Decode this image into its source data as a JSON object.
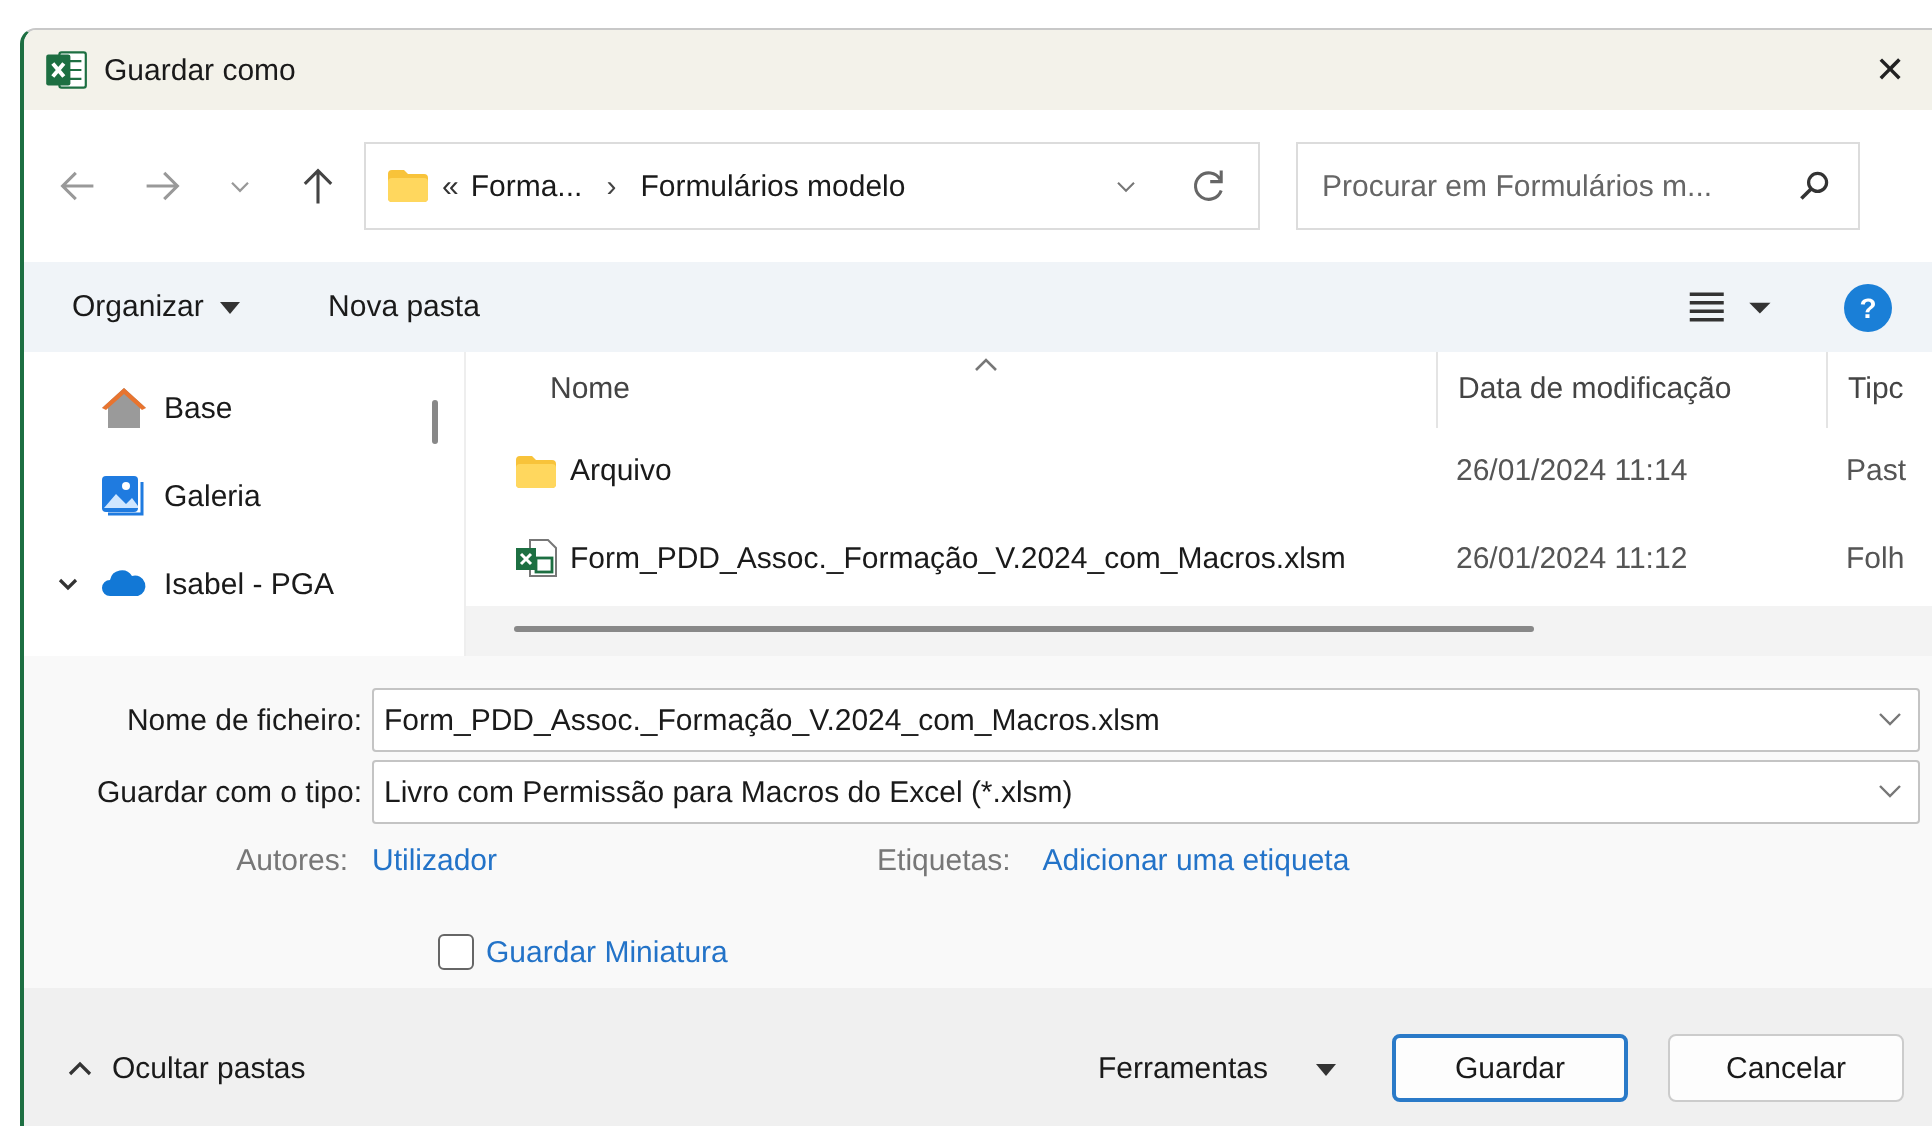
{
  "window": {
    "title": "Guardar como",
    "close": "✕"
  },
  "breadcrumb": {
    "overflow": "«",
    "parts": [
      "Forma...",
      "Formulários modelo"
    ],
    "separator": "›"
  },
  "search": {
    "placeholder": "Procurar em Formulários m..."
  },
  "toolbar": {
    "organize": "Organizar",
    "new_folder": "Nova pasta",
    "help": "?"
  },
  "sidebar": {
    "items": [
      {
        "label": "Base",
        "kind": "home",
        "expanded": false
      },
      {
        "label": "Galeria",
        "kind": "gallery",
        "expanded": false
      },
      {
        "label": "Isabel - PGA",
        "kind": "cloud",
        "expanded": true
      }
    ]
  },
  "table": {
    "columns": [
      "Nome",
      "Data de modificação",
      "Tipc"
    ],
    "rows": [
      {
        "kind": "folder",
        "name": "Arquivo",
        "date": "26/01/2024 11:14",
        "type": "Past"
      },
      {
        "kind": "excel",
        "name": "Form_PDD_Assoc._Formação_V.2024_com_Macros.xlsm",
        "date": "26/01/2024 11:12",
        "type": "Folh"
      }
    ]
  },
  "form": {
    "filename_label": "Nome de ficheiro:",
    "filename": "Form_PDD_Assoc._Formação_V.2024_com_Macros.xlsm",
    "type_label": "Guardar com o tipo:",
    "type": "Livro com Permissão para Macros do Excel (*.xlsm)",
    "authors_label": "Autores:",
    "authors": "Utilizador",
    "tags_label": "Etiquetas:",
    "tags": "Adicionar uma etiqueta",
    "thumbnail": {
      "label": "Guardar Miniatura",
      "checked": false
    }
  },
  "footer": {
    "hide_folders": "Ocultar pastas",
    "tools": "Ferramentas",
    "save": "Guardar",
    "cancel": "Cancelar"
  }
}
